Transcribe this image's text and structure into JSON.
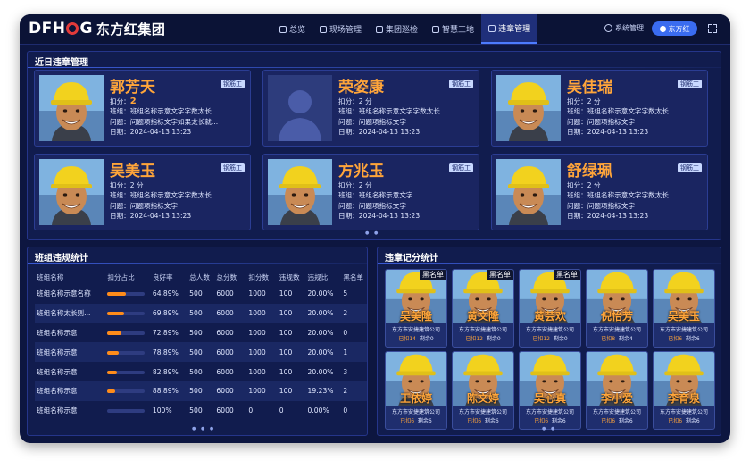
{
  "app": {
    "logo_latin": "DFH",
    "logo_latin2": "G",
    "logo_cn": "东方红集团"
  },
  "nav": [
    {
      "label": "总览",
      "icon": "overview-icon",
      "active": false
    },
    {
      "label": "现场管理",
      "icon": "site-icon",
      "active": false
    },
    {
      "label": "集团巡检",
      "icon": "inspection-icon",
      "active": false
    },
    {
      "label": "智慧工地",
      "icon": "smart-site-icon",
      "active": false
    },
    {
      "label": "违章管理",
      "icon": "violation-icon",
      "active": true
    }
  ],
  "system": {
    "label": "系统管理",
    "user": "东方红"
  },
  "recent": {
    "title": "近日违章管理",
    "cards": [
      {
        "name": "郭芳天",
        "trade": "钢筋工",
        "score_label": "扣分：",
        "score": "2",
        "team": "班组：班组名称示意文字字数太长...",
        "issue": "问题：问题项指标文字如果太长就...",
        "date": "日期：2024-04-13  13:23",
        "photo": true
      },
      {
        "name": "荣姿康",
        "trade": "钢筋工",
        "score_label": "扣分：",
        "score": "2 分",
        "team": "班组：班组名称示意文字字数太长...",
        "issue": "问题：问题项指标文字",
        "date": "日期：2024-04-13  13:23",
        "photo": false
      },
      {
        "name": "吴佳瑞",
        "trade": "钢筋工",
        "score_label": "扣分：",
        "score": "2 分",
        "team": "班组：班组名称示意文字字数太长...",
        "issue": "问题：问题项指标文字",
        "date": "日期：2024-04-13  13:23",
        "photo": true
      },
      {
        "name": "吴美玉",
        "trade": "钢筋工",
        "score_label": "扣分：",
        "score": "2 分",
        "team": "班组：班组名称示意文字字数太长...",
        "issue": "问题：问题项指标文字",
        "date": "日期：2024-04-13  13:23",
        "photo": true
      },
      {
        "name": "方兆玉",
        "trade": "钢筋工",
        "score_label": "扣分：",
        "score": "2 分",
        "team": "班组：班组名称示意文字",
        "issue": "问题：问题项指标文字",
        "date": "日期：2024-04-13  13:23",
        "photo": true
      },
      {
        "name": "舒绿珮",
        "trade": "钢筋工",
        "score_label": "扣分：",
        "score": "2 分",
        "team": "班组：班组名称示意文字字数太长...",
        "issue": "问题：问题项指标文字",
        "date": "日期：2024-04-13  13:23",
        "photo": true
      }
    ]
  },
  "team_stats": {
    "title": "班组违规统计",
    "headers": [
      "班组名称",
      "扣分占比",
      "良好率",
      "总人数",
      "总分数",
      "扣分数",
      "违规数",
      "违规比",
      "黑名单"
    ],
    "rows": [
      {
        "name": "班组名称示意名称",
        "ratio": 0.5,
        "good": "64.89%",
        "total": "500",
        "score": "6000",
        "deduct": "1000",
        "count": "100",
        "pct": "20.00%",
        "black": "5"
      },
      {
        "name": "班组名称太长则...",
        "ratio": 0.45,
        "good": "69.89%",
        "total": "500",
        "score": "6000",
        "deduct": "1000",
        "count": "100",
        "pct": "20.00%",
        "black": "2"
      },
      {
        "name": "班组名称示意",
        "ratio": 0.38,
        "good": "72.89%",
        "total": "500",
        "score": "6000",
        "deduct": "1000",
        "count": "100",
        "pct": "20.00%",
        "black": "0"
      },
      {
        "name": "班组名称示意",
        "ratio": 0.3,
        "good": "78.89%",
        "total": "500",
        "score": "6000",
        "deduct": "1000",
        "count": "100",
        "pct": "20.00%",
        "black": "1"
      },
      {
        "name": "班组名称示意",
        "ratio": 0.25,
        "good": "82.89%",
        "total": "500",
        "score": "6000",
        "deduct": "1000",
        "count": "100",
        "pct": "20.00%",
        "black": "3"
      },
      {
        "name": "班组名称示意",
        "ratio": 0.2,
        "good": "88.89%",
        "total": "500",
        "score": "6000",
        "deduct": "1000",
        "count": "100",
        "pct": "19.23%",
        "black": "2"
      },
      {
        "name": "班组名称示意",
        "ratio": 0.0,
        "good": "100%",
        "total": "500",
        "score": "6000",
        "deduct": "0",
        "count": "0",
        "pct": "0.00%",
        "black": "0"
      }
    ]
  },
  "score_stats": {
    "title": "违章记分统计",
    "black_label": "黑名单",
    "workers": [
      {
        "name": "吴美隆",
        "company": "东方市安捷建筑公司",
        "used": "已扣14",
        "left": "剩余0",
        "black": true
      },
      {
        "name": "黄文隆",
        "company": "东方市安捷建筑公司",
        "used": "已扣12",
        "left": "剩余0",
        "black": true
      },
      {
        "name": "黄芸欢",
        "company": "东方市安捷建筑公司",
        "used": "已扣12",
        "left": "剩余0",
        "black": true
      },
      {
        "name": "倪怡芳",
        "company": "东方市安捷建筑公司",
        "used": "已扣8",
        "left": "剩余4",
        "black": false
      },
      {
        "name": "吴美玉",
        "company": "东方市安捷建筑公司",
        "used": "已扣6",
        "left": "剩余6",
        "black": false
      },
      {
        "name": "王依婷",
        "company": "东方市安捷建筑公司",
        "used": "已扣6",
        "left": "剩余6",
        "black": false
      },
      {
        "name": "陈文婷",
        "company": "东方市安捷建筑公司",
        "used": "已扣6",
        "left": "剩余6",
        "black": false
      },
      {
        "name": "吴心真",
        "company": "东方市安捷建筑公司",
        "used": "已扣6",
        "left": "剩余6",
        "black": false
      },
      {
        "name": "李小爱",
        "company": "东方市安捷建筑公司",
        "used": "已扣6",
        "left": "剩余6",
        "black": false
      },
      {
        "name": "李育泉",
        "company": "东方市安捷建筑公司",
        "used": "已扣6",
        "left": "剩余6",
        "black": false
      }
    ]
  },
  "colors": {
    "accent": "#ffa53a",
    "background": "#0d1640",
    "primary": "#3a6cf0"
  }
}
